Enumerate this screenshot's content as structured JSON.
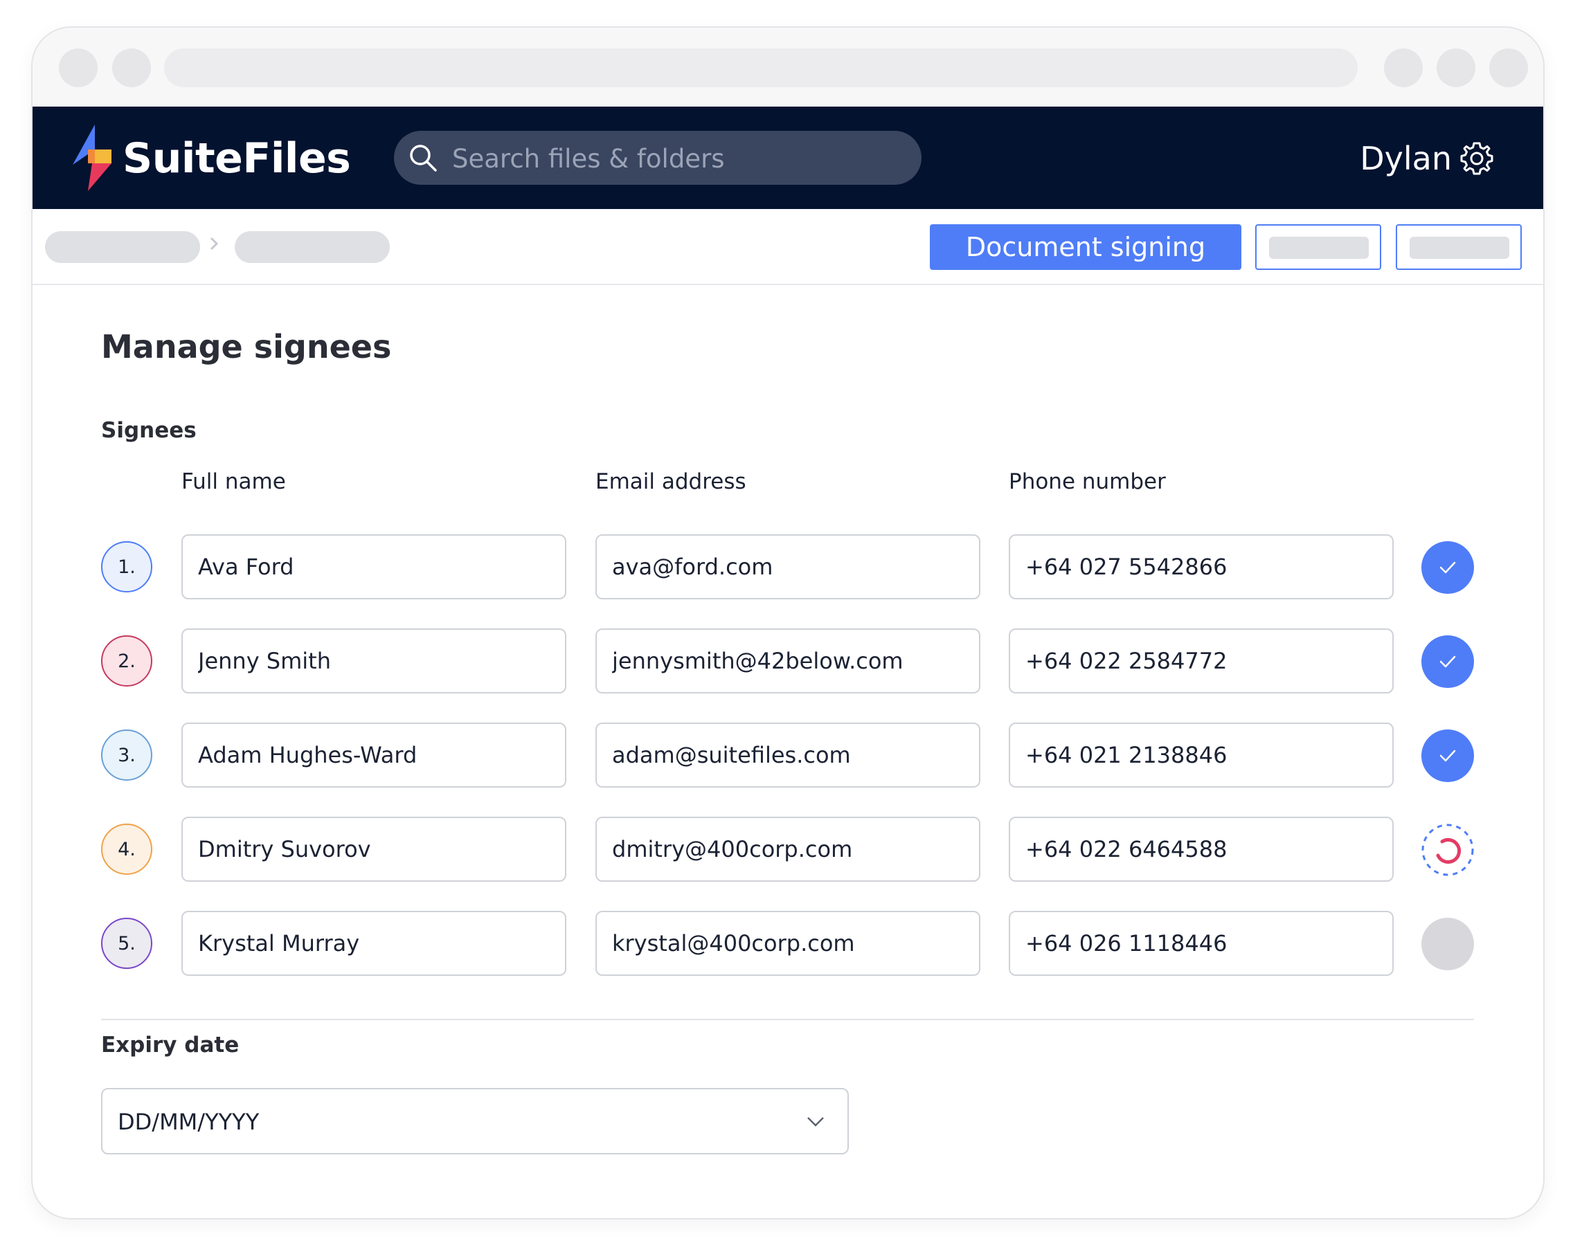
{
  "app": {
    "brand": "SuiteFiles",
    "user_name": "Dylan",
    "accent": "#4f7df7",
    "header_bg": "#03122f"
  },
  "search": {
    "placeholder": "Search files & folders",
    "icon": "search-icon"
  },
  "toolbar": {
    "primary_label": "Document signing"
  },
  "page": {
    "title": "Manage signees",
    "signees_label": "Signees",
    "columns": {
      "name": "Full name",
      "email": "Email address",
      "phone": "Phone number"
    },
    "signees": [
      {
        "index": "1.",
        "name": "Ava Ford",
        "email": "ava@ford.com",
        "phone": "+64 027 5542866",
        "status": "done",
        "color": "#4f7df7",
        "fill": "#eaf1fd"
      },
      {
        "index": "2.",
        "name": "Jenny Smith",
        "email": "jennysmith@42below.com",
        "phone": "+64 022 2584772",
        "status": "done",
        "color": "#c73a5e",
        "fill": "#fbe3e8"
      },
      {
        "index": "3.",
        "name": "Adam Hughes-Ward",
        "email": "adam@suitefiles.com",
        "phone": "+64 021 2138846",
        "status": "done",
        "color": "#6aa0d8",
        "fill": "#e8f3fb"
      },
      {
        "index": "4.",
        "name": "Dmitry Suvorov",
        "email": "dmitry@400corp.com",
        "phone": "+64 022 6464588",
        "status": "in-progress",
        "color": "#f0a24a",
        "fill": "#fdf1e4"
      },
      {
        "index": "5.",
        "name": "Krystal Murray",
        "email": "krystal@400corp.com",
        "phone": "+64 026 1118446",
        "status": "pending",
        "color": "#7a48c9",
        "fill": "#ecebf2"
      }
    ],
    "expiry_label": "Expiry date",
    "expiry_value": "DD/MM/YYYY"
  }
}
